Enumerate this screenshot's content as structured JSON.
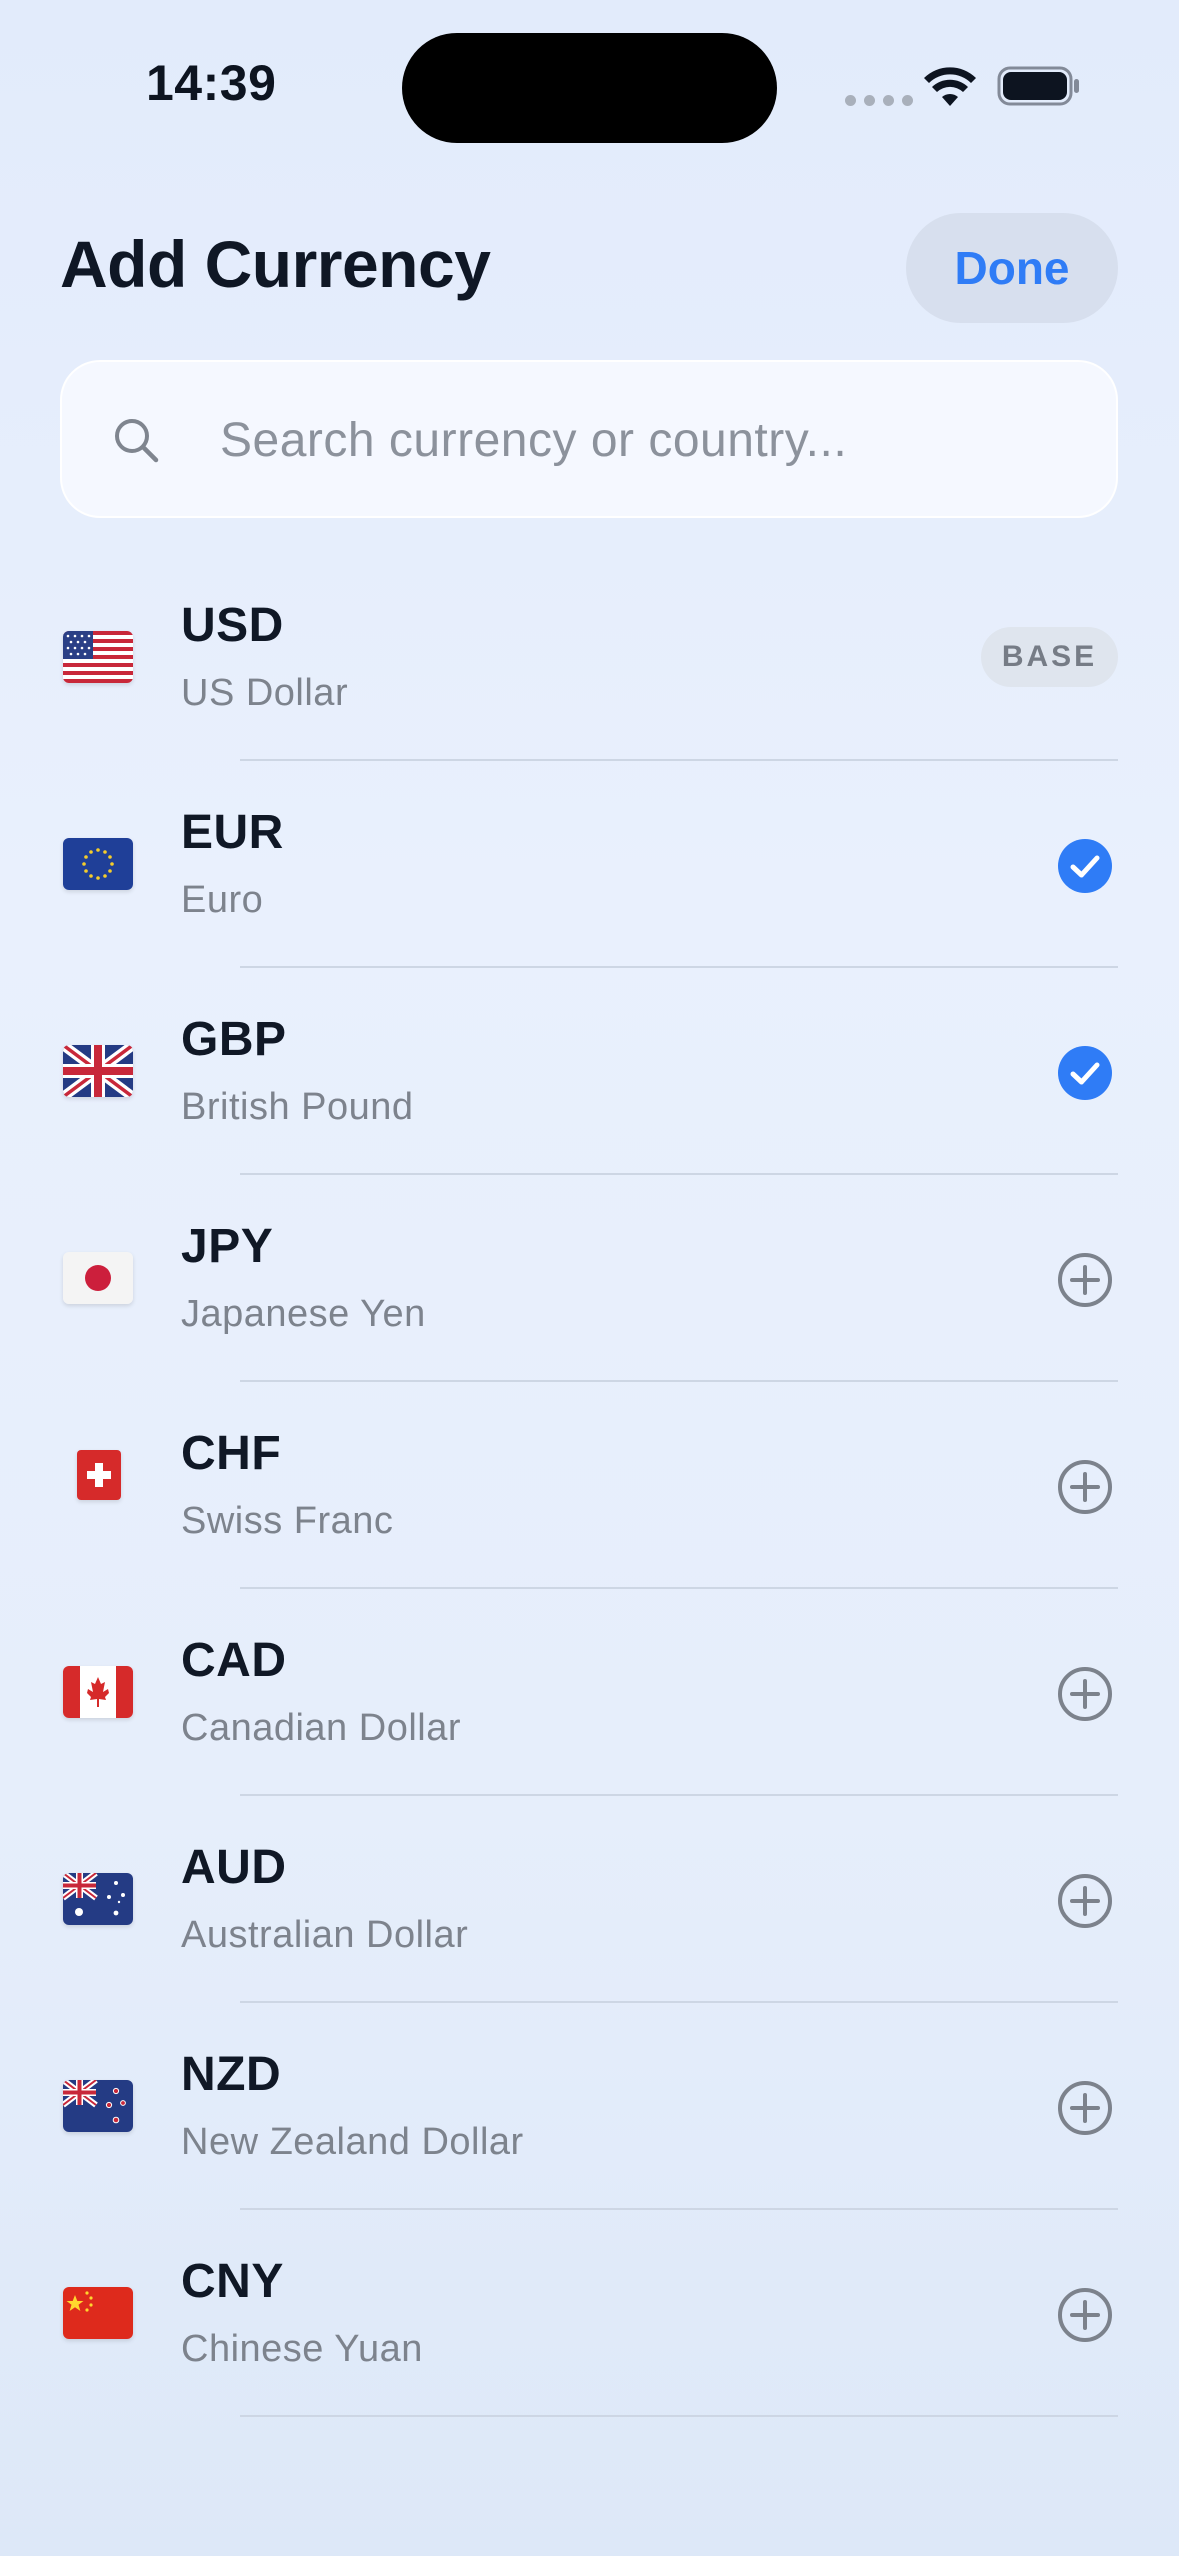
{
  "status_bar": {
    "time": "14:39",
    "icons": [
      "signal-dots-icon",
      "wifi-icon",
      "battery-icon"
    ]
  },
  "header": {
    "title": "Add Currency",
    "done_label": "Done"
  },
  "search": {
    "placeholder": "Search currency or country..."
  },
  "colors": {
    "accent": "#2f7cf6",
    "checkmark": "#2f7cf6",
    "add_icon": "#7c828c"
  },
  "currencies": [
    {
      "code": "USD",
      "name": "US Dollar",
      "flag": "us-flag-icon",
      "state": "base",
      "badge": "BASE"
    },
    {
      "code": "EUR",
      "name": "Euro",
      "flag": "eu-flag-icon",
      "state": "selected"
    },
    {
      "code": "GBP",
      "name": "British Pound",
      "flag": "uk-flag-icon",
      "state": "selected"
    },
    {
      "code": "JPY",
      "name": "Japanese Yen",
      "flag": "japan-flag-icon",
      "state": "add"
    },
    {
      "code": "CHF",
      "name": "Swiss Franc",
      "flag": "switzerland-flag-icon",
      "state": "add"
    },
    {
      "code": "CAD",
      "name": "Canadian Dollar",
      "flag": "canada-flag-icon",
      "state": "add"
    },
    {
      "code": "AUD",
      "name": "Australian Dollar",
      "flag": "australia-flag-icon",
      "state": "add"
    },
    {
      "code": "NZD",
      "name": "New Zealand Dollar",
      "flag": "new-zealand-flag-icon",
      "state": "add"
    },
    {
      "code": "CNY",
      "name": "Chinese Yuan",
      "flag": "china-flag-icon",
      "state": "add"
    }
  ]
}
